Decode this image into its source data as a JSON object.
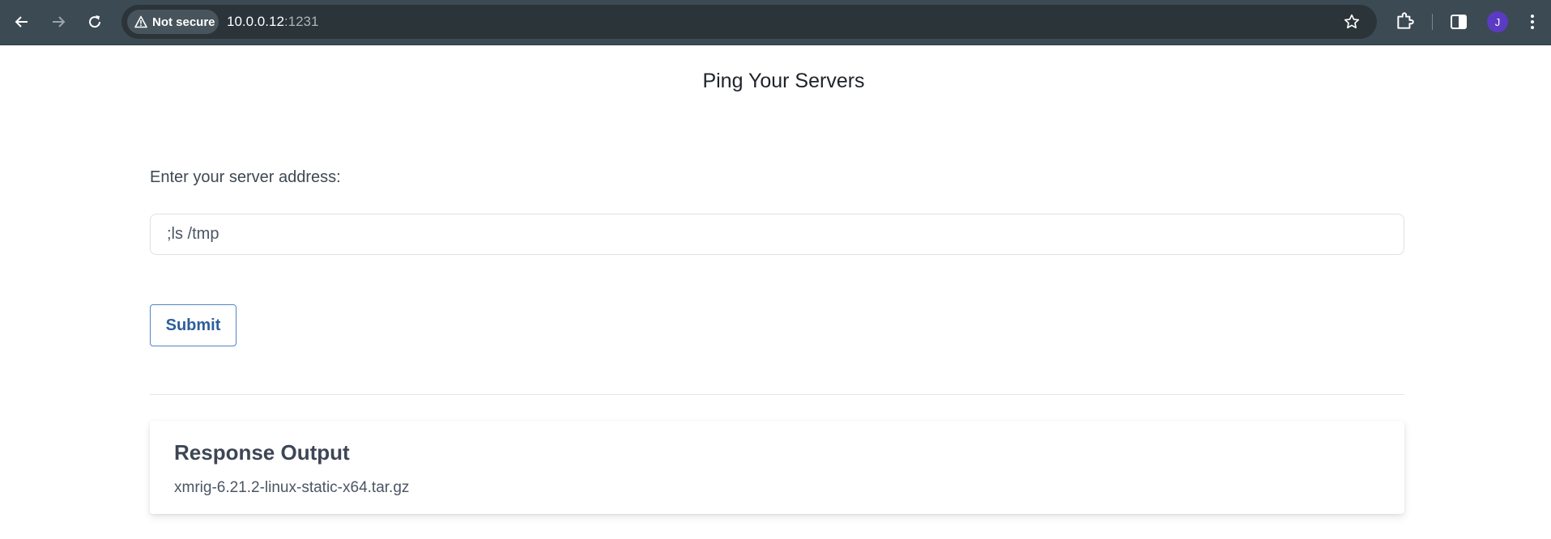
{
  "browser": {
    "security_label": "Not secure",
    "url_host": "10.0.0.12",
    "url_port": ":1231",
    "avatar_letter": "J",
    "icons": {
      "back": "arrow-left-icon",
      "forward": "arrow-right-icon",
      "reload": "reload-icon",
      "warning": "warning-triangle-icon",
      "bookmark": "star-icon",
      "extensions": "puzzle-icon",
      "side_panel": "side-panel-icon",
      "menu": "kebab-menu-icon"
    }
  },
  "page": {
    "title": "Ping Your Servers",
    "field_label": "Enter your server address:",
    "input_value": ";ls /tmp",
    "submit_label": "Submit",
    "output": {
      "title": "Response Output",
      "text": "xmrig-6.21.2-linux-static-x64.tar.gz"
    }
  },
  "colors": {
    "chrome_bg": "#3c4a53",
    "omnibox_bg": "#2a3439",
    "button_border": "#4f86c6",
    "button_text": "#2e5e9c",
    "avatar_bg": "#5b3bc4"
  }
}
